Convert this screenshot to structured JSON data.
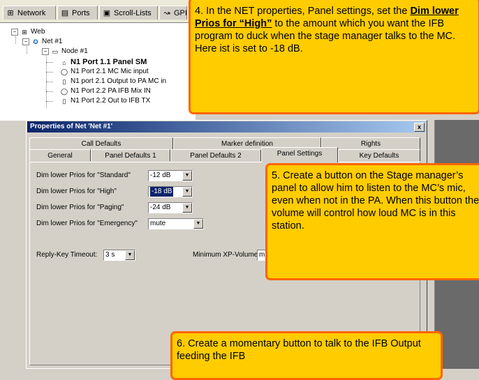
{
  "toolbar_tabs": [
    {
      "label": "Network",
      "icon": "network-icon"
    },
    {
      "label": "Ports",
      "icon": "ports-icon"
    },
    {
      "label": "Scroll-Lists",
      "icon": "scroll-lists-icon"
    },
    {
      "label": "GPI",
      "icon": "gpi-icon"
    }
  ],
  "tree": {
    "web": "Web",
    "net": "Net #1",
    "node": "Node #1",
    "items": [
      "N1 Port 1.1 Panel SM",
      "N1 Port 2.1  MC Mic input",
      "N1 port 2.1 Output to PA MC in",
      "N1 Port 2.2 PA IFB Mix IN",
      "N1 Port 2.2 Out to IFB TX"
    ]
  },
  "dialog": {
    "title": "Properties of Net 'Net #1'",
    "close": "x",
    "tabs_row1": [
      "Call Defaults",
      "Marker definition",
      "Rights"
    ],
    "tabs_row2": [
      "General",
      "Panel Defaults 1",
      "Panel Defaults 2",
      "Panel Settings",
      "Key Defaults"
    ],
    "active_tab": "Panel Settings",
    "fields": [
      {
        "label": "Dim lower Prios for \"Standard\"",
        "value": "-12 dB",
        "selected": false
      },
      {
        "label": "Dim lower Prios for \"High\"",
        "value": "-18 dB",
        "selected": true
      },
      {
        "label": "Dim lower Prios for \"Paging\"",
        "value": "-24 dB",
        "selected": false
      },
      {
        "label": "Dim lower Prios for \"Emergency\"",
        "value": "mute",
        "selected": false
      }
    ],
    "reply_key_label": "Reply-Key Timeout:",
    "reply_key_value": "3 s",
    "min_xp_label": "Minimum XP-Volume:",
    "min_xp_value": "mute"
  },
  "callouts": {
    "c4_pre": "4.  In the NET properties, Panel settings, set the  ",
    "c4_bold": "Dim lower Prios for “High”",
    "c4_post": " to the amount which you want the IFB program to duck when the stage manager talks to the MC. Here ist is set to -18 dB.",
    "c5": "5.  Create a button on the Stage manager’s panel to allow him to listen to the MC’s mic, even when not in the PA.  When this button the volume will control how loud MC is in this station.",
    "c6": "6. Create a momentary button to talk to the IFB Output feeding the IFB"
  },
  "colors": {
    "callout_fill": "#ffcc00",
    "callout_border": "#ff6600",
    "title_bar": "#0a246a"
  }
}
